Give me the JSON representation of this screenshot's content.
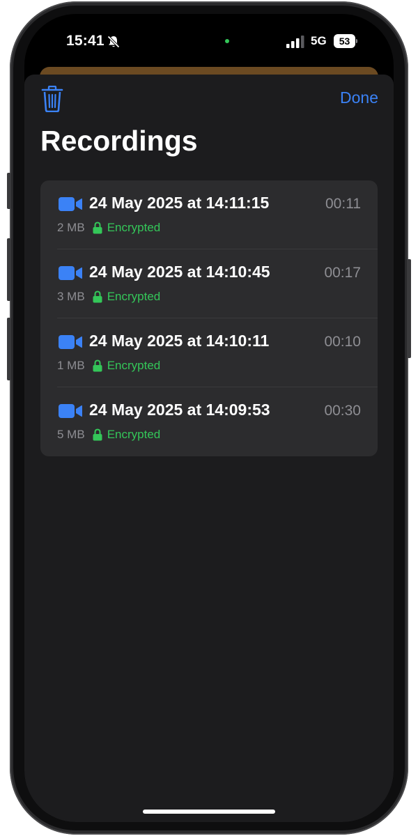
{
  "status_bar": {
    "time": "15:41",
    "network": "5G",
    "battery": "53"
  },
  "header": {
    "done_label": "Done",
    "title": "Recordings"
  },
  "icons": {
    "delete": "trash-icon",
    "recording": "video-camera-icon",
    "encryption": "lock-icon",
    "silent": "bell-slash-icon"
  },
  "colors": {
    "accent": "#3b82f6",
    "encrypted": "#34c759",
    "sheet_bg": "#1c1c1e",
    "row_bg": "#2c2c2e"
  },
  "recordings": [
    {
      "title": "24 May 2025 at 14:11:15",
      "duration": "00:11",
      "size": "2 MB",
      "status": "Encrypted"
    },
    {
      "title": "24 May 2025 at 14:10:45",
      "duration": "00:17",
      "size": "3 MB",
      "status": "Encrypted"
    },
    {
      "title": "24 May 2025 at 14:10:11",
      "duration": "00:10",
      "size": "1 MB",
      "status": "Encrypted"
    },
    {
      "title": "24 May 2025 at 14:09:53",
      "duration": "00:30",
      "size": "5 MB",
      "status": "Encrypted"
    }
  ]
}
